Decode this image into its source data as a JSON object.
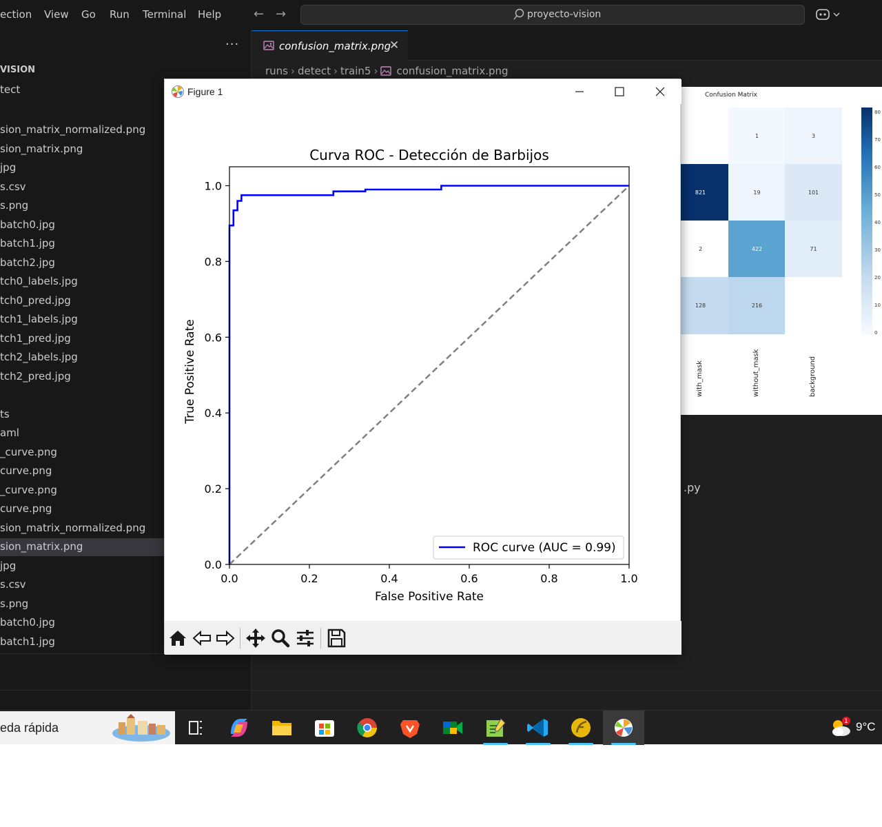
{
  "menu": {
    "items": [
      "ection",
      "View",
      "Go",
      "Run",
      "Terminal",
      "Help"
    ]
  },
  "command_center": {
    "text": "proyecto-vision"
  },
  "sidebar": {
    "dots": "···",
    "explorer_title": "VISION",
    "folder_label": "tect",
    "files": [
      "sion_matrix_normalized.png",
      "sion_matrix.png",
      "jpg",
      "s.csv",
      "s.png",
      "batch0.jpg",
      "batch1.jpg",
      "batch2.jpg",
      "tch0_labels.jpg",
      "tch0_pred.jpg",
      "tch1_labels.jpg",
      "tch1_pred.jpg",
      "tch2_labels.jpg",
      "tch2_pred.jpg",
      "",
      "ts",
      "aml",
      "_curve.png",
      "curve.png",
      "_curve.png",
      "curve.png",
      "sion_matrix_normalized.png",
      "sion_matrix.png",
      "jpg",
      "s.csv",
      "s.png",
      "batch0.jpg",
      "batch1.jpg"
    ],
    "selected_index": 22
  },
  "editor": {
    "tab_label": "confusion_matrix.png",
    "tab_close": "✕",
    "breadcrumb": [
      "runs",
      "detect",
      "train5",
      "confusion_matrix.png"
    ],
    "partial_text": ".py"
  },
  "confusion_matrix": {
    "title": "Confusion Matrix",
    "cells": [
      [
        "",
        "1",
        "3"
      ],
      [
        "821",
        "19",
        "101"
      ],
      [
        "2",
        "422",
        "71"
      ],
      [
        "128",
        "216",
        ""
      ]
    ],
    "x_labels": [
      "with_mask",
      "without_mask",
      "background"
    ],
    "colorbar_ticks": [
      "80",
      "70",
      "60",
      "50",
      "40",
      "30",
      "20",
      "10",
      "0"
    ]
  },
  "figure": {
    "window_title": "Figure 1",
    "minimize": "—",
    "maximize": "☐",
    "close": "✕"
  },
  "chart_data": {
    "type": "line",
    "title": "Curva ROC - Detección de Barbijos",
    "xlabel": "False Positive Rate",
    "ylabel": "True Positive Rate",
    "xlim": [
      0.0,
      1.0
    ],
    "ylim": [
      0.0,
      1.05
    ],
    "xticks": [
      "0.0",
      "0.2",
      "0.4",
      "0.6",
      "0.8",
      "1.0"
    ],
    "yticks": [
      "0.0",
      "0.2",
      "0.4",
      "0.6",
      "0.8",
      "1.0"
    ],
    "grid": false,
    "legend_position": "lower-right",
    "series": [
      {
        "name": "ROC curve (AUC = 0.99)",
        "color": "#0000ff",
        "style": "solid",
        "x": [
          0.0,
          0.0,
          0.01,
          0.01,
          0.02,
          0.02,
          0.03,
          0.03,
          0.04,
          0.04,
          0.26,
          0.26,
          0.34,
          0.34,
          0.53,
          0.53,
          1.0
        ],
        "y": [
          0.0,
          0.895,
          0.895,
          0.935,
          0.935,
          0.96,
          0.96,
          0.975,
          0.975,
          0.975,
          0.975,
          0.985,
          0.985,
          0.99,
          0.99,
          1.0,
          1.0
        ]
      },
      {
        "color": "#808080",
        "style": "dashed",
        "x": [
          0.0,
          1.0
        ],
        "y": [
          0.0,
          1.0
        ]
      }
    ]
  },
  "taskbar": {
    "search_text": "eda rápida",
    "apps": [
      "task-view",
      "copilot",
      "file-explorer",
      "microsoft-store",
      "chrome",
      "brave",
      "meet",
      "notepad-plus",
      "vscode",
      "app-yellow",
      "matplotlib-figure"
    ],
    "active_app": "matplotlib-figure",
    "weather_temp": "9°C",
    "weather_badge": "1"
  }
}
